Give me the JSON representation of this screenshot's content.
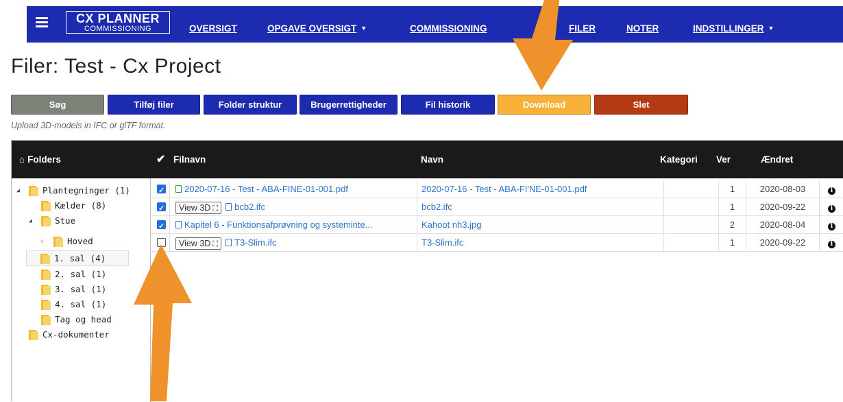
{
  "nav": {
    "brand_line1": "CX PLANNER",
    "brand_line2": "COMMISSIONING",
    "links": [
      "OVERSIGT",
      "OPGAVE OVERSIGT",
      "COMMISSIONING",
      "FILER",
      "NOTER",
      "INDSTILLINGER"
    ]
  },
  "page_title": "Filer: Test - Cx Project",
  "toolbar": {
    "buttons": [
      "Søg",
      "Tilføj filer",
      "Folder struktur",
      "Brugerrettigheder",
      "Fil historik",
      "Download",
      "Slet"
    ],
    "colors": [
      "#7d8279",
      "#1c2bb0",
      "#1c2bb0",
      "#1c2bb0",
      "#1c2bb0",
      "#f9b238",
      "#b53a13"
    ]
  },
  "hint": "Upload 3D-models in IFC or glTF format.",
  "headers": {
    "folders": "Folders",
    "filnavn": "Filnavn",
    "navn": "Navn",
    "kategori": "Kategori",
    "ver": "Ver",
    "aendret": "Ændret"
  },
  "tree": [
    {
      "label": "Plantegninger (1)",
      "toggle": "open"
    },
    {
      "label": "Kælder (8)"
    },
    {
      "label": "Stue",
      "toggle": "open"
    },
    {
      "label": "Hoved",
      "toggle": "closed"
    },
    {
      "label": "1. sal (4)",
      "selected": true
    },
    {
      "label": "2. sal (1)"
    },
    {
      "label": "3. sal (1)"
    },
    {
      "label": "4. sal (1)"
    },
    {
      "label": "Tag og head"
    },
    {
      "label": "Cx-dokumenter"
    }
  ],
  "view3d_label": "View 3D",
  "files": [
    {
      "checked": true,
      "view3d": false,
      "filnavn": "2020-07-16 - Test - ABA-FINE-01-001.pdf",
      "navn": "2020-07-16 - Test - ABA-FI'NE-01-001.pdf",
      "kategori": "",
      "ver": "1",
      "aendret": "2020-08-03",
      "icon_color": "#2f9a3a"
    },
    {
      "checked": true,
      "view3d": true,
      "filnavn": "bcb2.ifc",
      "navn": "bcb2.ifc",
      "kategori": "",
      "ver": "1",
      "aendret": "2020-09-22",
      "icon_color": "#2f74d0"
    },
    {
      "checked": true,
      "view3d": false,
      "filnavn": "Kapitel 6 - Funktionsafprøvning og systeminte...",
      "navn": "Kahoot nh3.jpg",
      "kategori": "",
      "ver": "2",
      "aendret": "2020-08-04",
      "icon_color": "#2f74d0"
    },
    {
      "checked": false,
      "view3d": true,
      "filnavn": "T3-Slim.ifc",
      "navn": "T3-Slim.ifc",
      "kategori": "",
      "ver": "1",
      "aendret": "2020-09-22",
      "icon_color": "#2f74d0"
    }
  ],
  "accent_arrow_color": "#f0922c"
}
